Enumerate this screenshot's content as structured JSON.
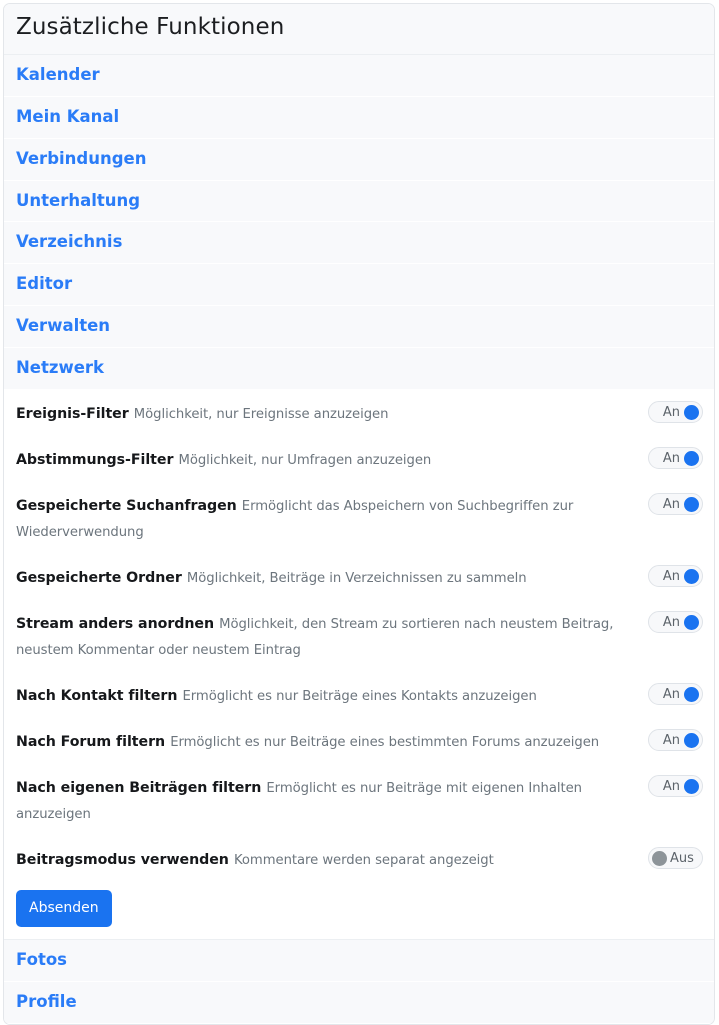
{
  "panel": {
    "title": "Zusätzliche Funktionen"
  },
  "top_links": [
    {
      "label": "Kalender"
    },
    {
      "label": "Mein Kanal"
    },
    {
      "label": "Verbindungen"
    },
    {
      "label": "Unterhaltung"
    },
    {
      "label": "Verzeichnis"
    },
    {
      "label": "Editor"
    },
    {
      "label": "Verwalten"
    },
    {
      "label": "Netzwerk"
    }
  ],
  "settings": [
    {
      "label": "Ereignis-Filter",
      "description": "Möglichkeit, nur Ereignisse anzuzeigen",
      "state": "on",
      "state_label": "An"
    },
    {
      "label": "Abstimmungs-Filter",
      "description": "Möglichkeit, nur Umfragen anzuzeigen",
      "state": "on",
      "state_label": "An"
    },
    {
      "label": "Gespeicherte Suchanfragen",
      "description": "Ermöglicht das Abspeichern von Suchbegriffen zur Wiederverwendung",
      "state": "on",
      "state_label": "An"
    },
    {
      "label": "Gespeicherte Ordner",
      "description": "Möglichkeit, Beiträge in Verzeichnissen zu sammeln",
      "state": "on",
      "state_label": "An"
    },
    {
      "label": "Stream anders anordnen",
      "description": "Möglichkeit, den Stream zu sortieren nach neustem Beitrag, neustem Kommentar oder neustem Eintrag",
      "state": "on",
      "state_label": "An"
    },
    {
      "label": "Nach Kontakt filtern",
      "description": "Ermöglicht es nur Beiträge eines Kontakts anzuzeigen",
      "state": "on",
      "state_label": "An"
    },
    {
      "label": "Nach Forum filtern",
      "description": "Ermöglicht es nur Beiträge eines bestimmten Forums anzuzeigen",
      "state": "on",
      "state_label": "An"
    },
    {
      "label": "Nach eigenen Beiträgen filtern",
      "description": "Ermöglicht es nur Beiträge mit eigenen Inhalten anzuzeigen",
      "state": "on",
      "state_label": "An"
    },
    {
      "label": "Beitragsmodus verwenden",
      "description": "Kommentare werden separat angezeigt",
      "state": "off",
      "state_label": "Aus"
    }
  ],
  "submit": {
    "label": "Absenden"
  },
  "bottom_links": [
    {
      "label": "Fotos"
    },
    {
      "label": "Profile"
    }
  ],
  "colors": {
    "link": "#2a7cf7",
    "accent": "#1a73f0",
    "toggle_off_knob": "#8d9499",
    "row_background": "#f8f9fb",
    "label_text": "#16181b",
    "description_text": "#6c757d"
  }
}
